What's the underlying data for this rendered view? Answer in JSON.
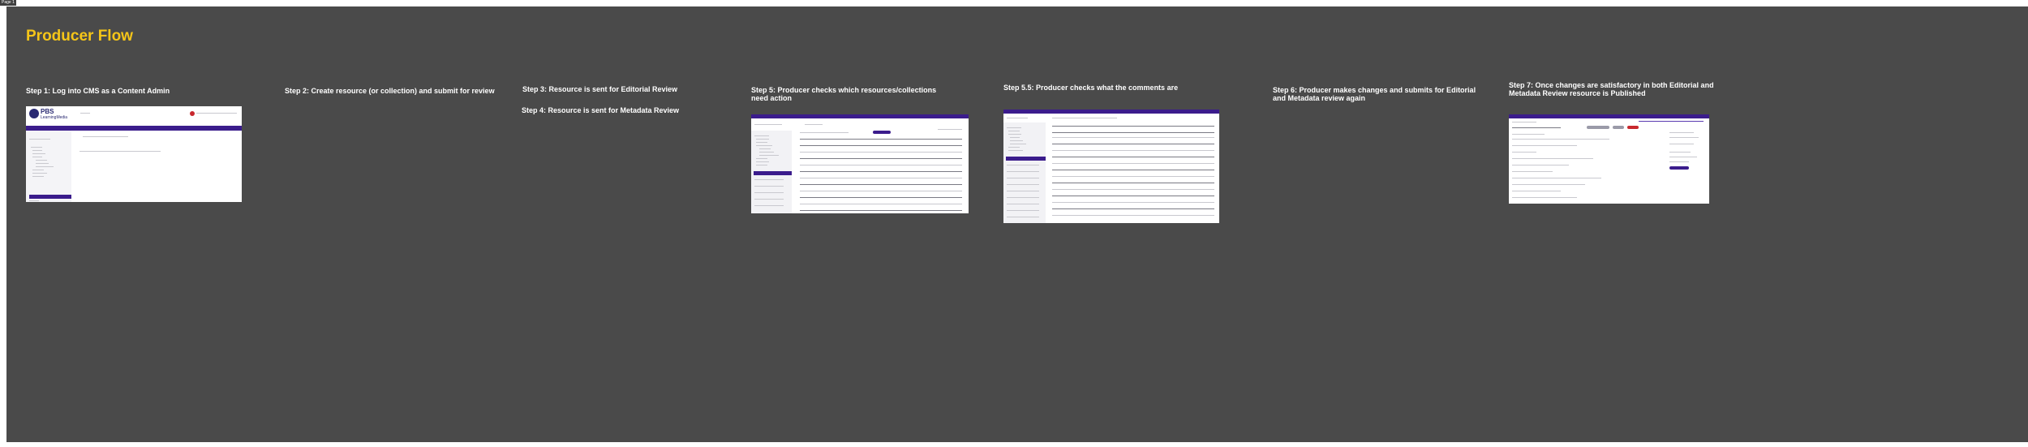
{
  "page_tag": "Page 1",
  "title": "Producer Flow",
  "colors": {
    "background": "#4a4a4a",
    "title": "#f5c518",
    "step_text": "#ffffff",
    "brand_purple": "#3b1c8c"
  },
  "steps": [
    {
      "label": "Step 1: Log into CMS as a Content Admin"
    },
    {
      "label": "Step 2: Create resource (or collection) and submit for review"
    },
    {
      "label": "Step 3: Resource is sent for Editorial Review"
    },
    {
      "label": "Step 4: Resource is sent for Metadata Review"
    },
    {
      "label": "Step 5: Producer checks which resources/collections need action"
    },
    {
      "label": "Step 5.5: Producer checks what the comments are"
    },
    {
      "label": "Step 6: Producer makes changes and submits for Editorial and Metadata review again"
    },
    {
      "label": "Step 7: Once changes are satisfactory in both Editorial and Metadata Review resource is Published"
    }
  ],
  "screenshot1": {
    "logo_text": "PBS",
    "logo_subtext": "LearningMedia"
  }
}
